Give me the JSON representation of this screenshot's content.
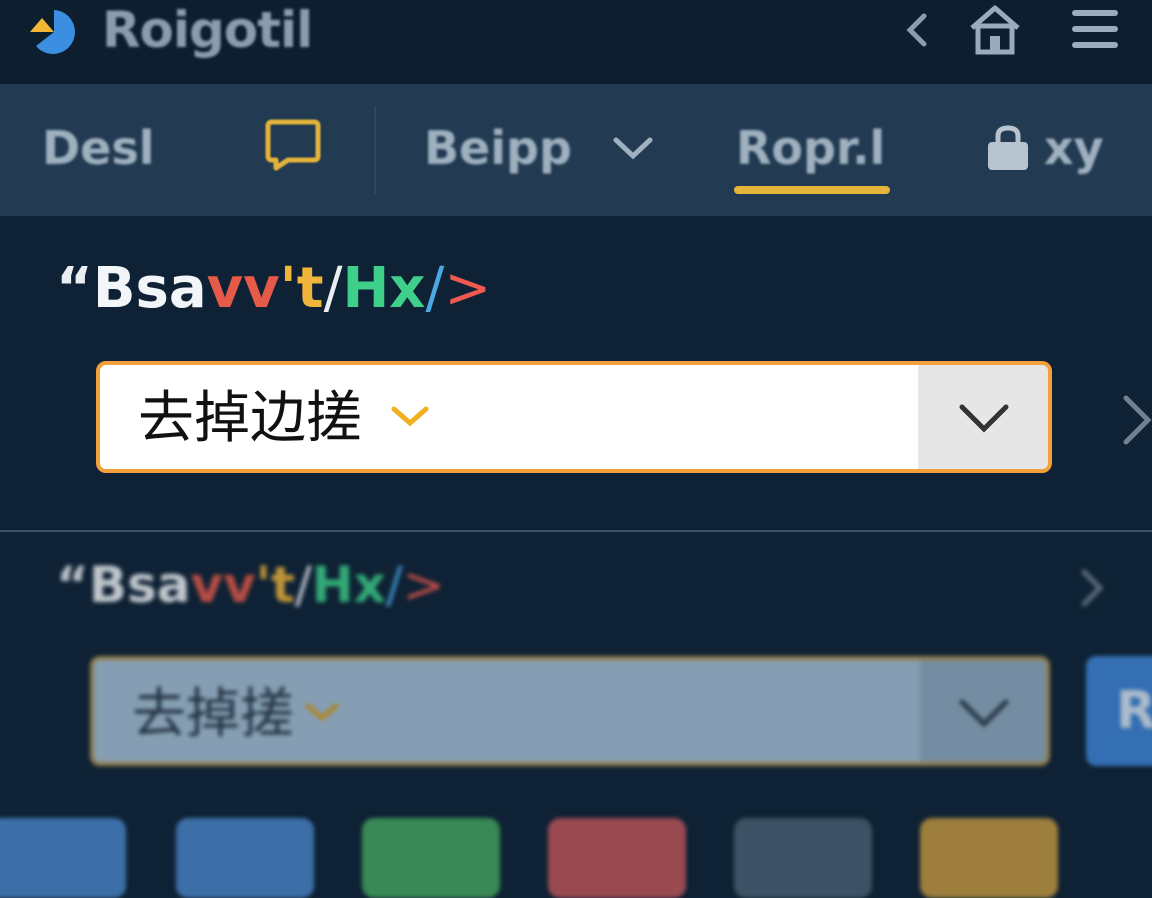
{
  "app": {
    "title": "Roigotil"
  },
  "header_icons": [
    "chevron-left-icon",
    "home-icon",
    "menu-icon"
  ],
  "nav": {
    "items": [
      {
        "label": "Desl"
      },
      {
        "label": "",
        "icon": "note-icon"
      },
      {
        "label": "Beipp",
        "has_dropdown": true
      },
      {
        "label": "Ropr.l",
        "active": true
      },
      {
        "label": "xy",
        "icon": "lock-icon"
      }
    ]
  },
  "editor": {
    "line_parts": {
      "quote": "“",
      "w": "Bsa",
      "r": "vv",
      "y": "'t",
      "slash1": "/",
      "g": "Hx",
      "slash2": "/",
      "arrow": ">"
    },
    "select_value": "去掉边搓"
  },
  "editor2": {
    "line_parts": {
      "quote": "“",
      "w": "Bsa",
      "r": "vv",
      "y": "'t",
      "slash1": "/",
      "g": "Hx",
      "slash2": "/",
      "arrow": ">"
    },
    "select_value": "去掉搓",
    "button_label": "R"
  },
  "colors": {
    "accent": "#f2a13a",
    "nav_underline": "#e5b43a",
    "background": "#0f2235",
    "navbar": "#223b53",
    "tiles": [
      "#4a86c9",
      "#4a86c9",
      "#45a85e",
      "#c2575a",
      "#4c6073",
      "#c79a3f"
    ]
  }
}
